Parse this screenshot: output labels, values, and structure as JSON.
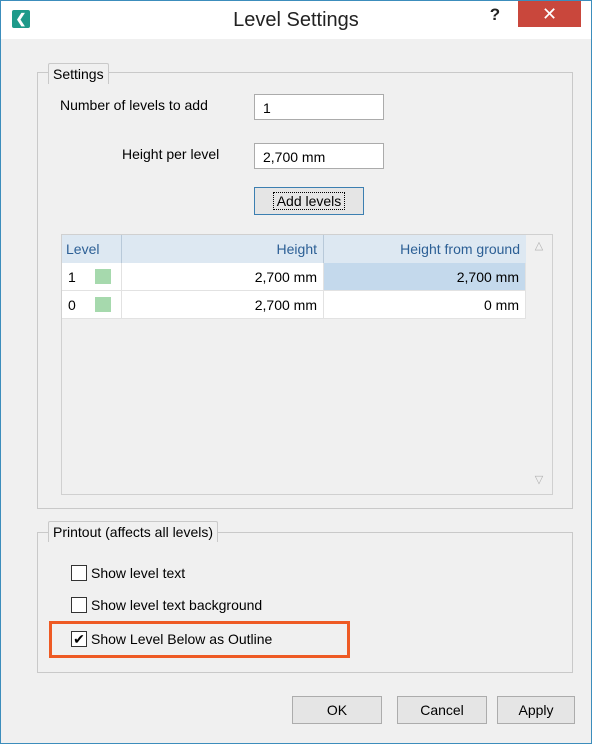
{
  "window": {
    "title": "Level Settings",
    "help_label": "?",
    "close_label": "✕",
    "app_icon": "back-arrow-icon"
  },
  "settings": {
    "group_title": "Settings",
    "num_levels_label": "Number of levels to add",
    "num_levels_value": "1",
    "height_label": "Height per level",
    "height_value": "2,700 mm",
    "add_levels_label": "Add levels"
  },
  "table": {
    "headers": [
      "Level",
      "Height",
      "Height from ground"
    ],
    "rows": [
      {
        "level": "1",
        "height": "2,700 mm",
        "height_from_ground": "2,700 mm",
        "swatch_color": "#a6d9ad"
      },
      {
        "level": "0",
        "height": "2,700 mm",
        "height_from_ground": "0 mm",
        "swatch_color": "#a6d9ad"
      }
    ]
  },
  "printout": {
    "group_title": "Printout (affects all levels)",
    "options": [
      {
        "label": "Show level text",
        "checked": false
      },
      {
        "label": "Show level text background",
        "checked": false
      },
      {
        "label": "Show Level Below as Outline",
        "checked": true
      }
    ]
  },
  "footer": {
    "ok_label": "OK",
    "cancel_label": "Cancel",
    "apply_label": "Apply"
  },
  "colors": {
    "highlight": "#ee5a24",
    "close_bg": "#c9473c",
    "header_bg": "#dde8f2",
    "selected_cell": "#c4d9ec"
  }
}
